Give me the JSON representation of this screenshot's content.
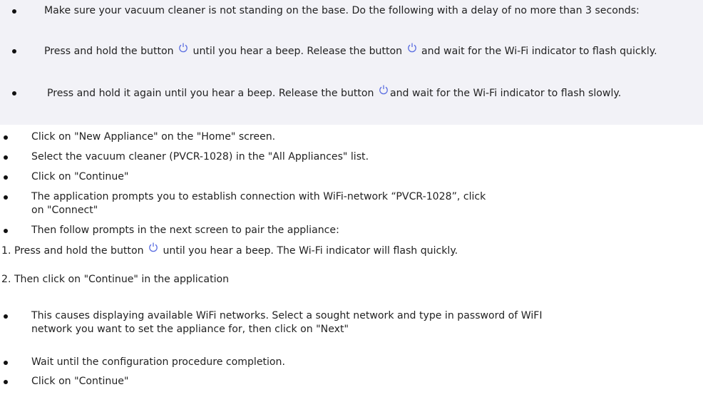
{
  "section_power_up": {
    "items": [
      {
        "text": "Make sure your vacuum cleaner is not standing on the base. Do the following with a delay of no more than 3 seconds:"
      },
      {
        "before_icon": "Press and hold the button",
        "between_icons": "until you hear a beep. Release the button",
        "after_icon": "and wait for the Wi-Fi indicator to flash quickly.",
        "icon": "power-icon"
      },
      {
        "before_icon": "Press and hold it again until you hear a beep. Release the button",
        "after_icon": "and wait for the Wi-Fi indicator to flash slowly.",
        "icon": "power-icon"
      }
    ]
  },
  "steps": [
    "Click on \"New Appliance\" on the \"Home\" screen.",
    "Select the vacuum cleaner (PVCR-1028) in the \"All Appliances\" list.",
    "Click on \"Continue\"",
    "The application prompts you to establish connection with WiFi-network “PVCR-1028”, click on \"Connect\"",
    "Then follow prompts in the next screen to pair the appliance:"
  ],
  "numbered": [
    {
      "number": "1.",
      "before_icon": "Press and hold the button",
      "after_icon": "until you hear a beep. The Wi-Fi indicator will flash quickly.",
      "icon": "power-icon"
    },
    {
      "number": "2.",
      "text": "Then click on \"Continue\" in the application"
    }
  ],
  "final_steps": [
    "This causes displaying available WiFi networks. Select a sought network and type in password of WiFI network you want to set the appliance for, then click on \"Next\"",
    "Wait until the configuration procedure completion.",
    "Click on \"Continue\""
  ],
  "colors": {
    "shaded_background": "#f2f2f7",
    "icon_stroke": "#5b6ee1"
  }
}
